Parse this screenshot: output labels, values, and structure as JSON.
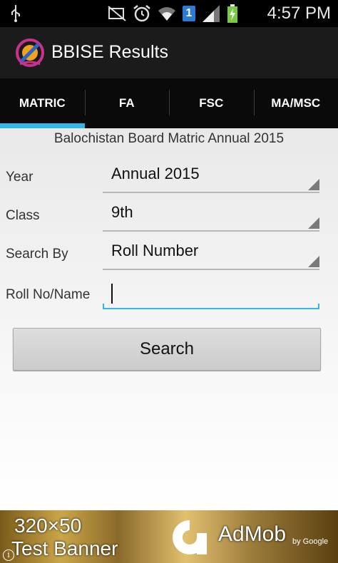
{
  "status_bar": {
    "time": "4:57 PM",
    "icons": [
      "usb-icon",
      "mute-icon",
      "alarm-icon",
      "wifi-icon",
      "sim-1-icon",
      "signal-icon",
      "battery-icon"
    ],
    "sim_label": "1"
  },
  "app_bar": {
    "title": "BBISE Results",
    "logo": "bbise-logo-icon"
  },
  "tabs": [
    {
      "label": "MATRIC",
      "active": true
    },
    {
      "label": "FA",
      "active": false
    },
    {
      "label": "FSC",
      "active": false
    },
    {
      "label": "MA/MSC",
      "active": false
    }
  ],
  "form": {
    "subtitle": "Balochistan Board Matric Annual 2015",
    "year_label": "Year",
    "year_value": "Annual 2015",
    "class_label": "Class",
    "class_value": "9th",
    "search_by_label": "Search By",
    "search_by_value": "Roll Number",
    "roll_label": "Roll No/Name",
    "roll_value": "",
    "search_button": "Search"
  },
  "ad": {
    "line1": "320×50",
    "line2": "Test Banner",
    "brand": "AdMob",
    "by": "by Google",
    "info": "i"
  },
  "colors": {
    "accent": "#33b5e5",
    "tab_bar": "#0a0a0a",
    "app_bar": "#1b1b1b"
  }
}
